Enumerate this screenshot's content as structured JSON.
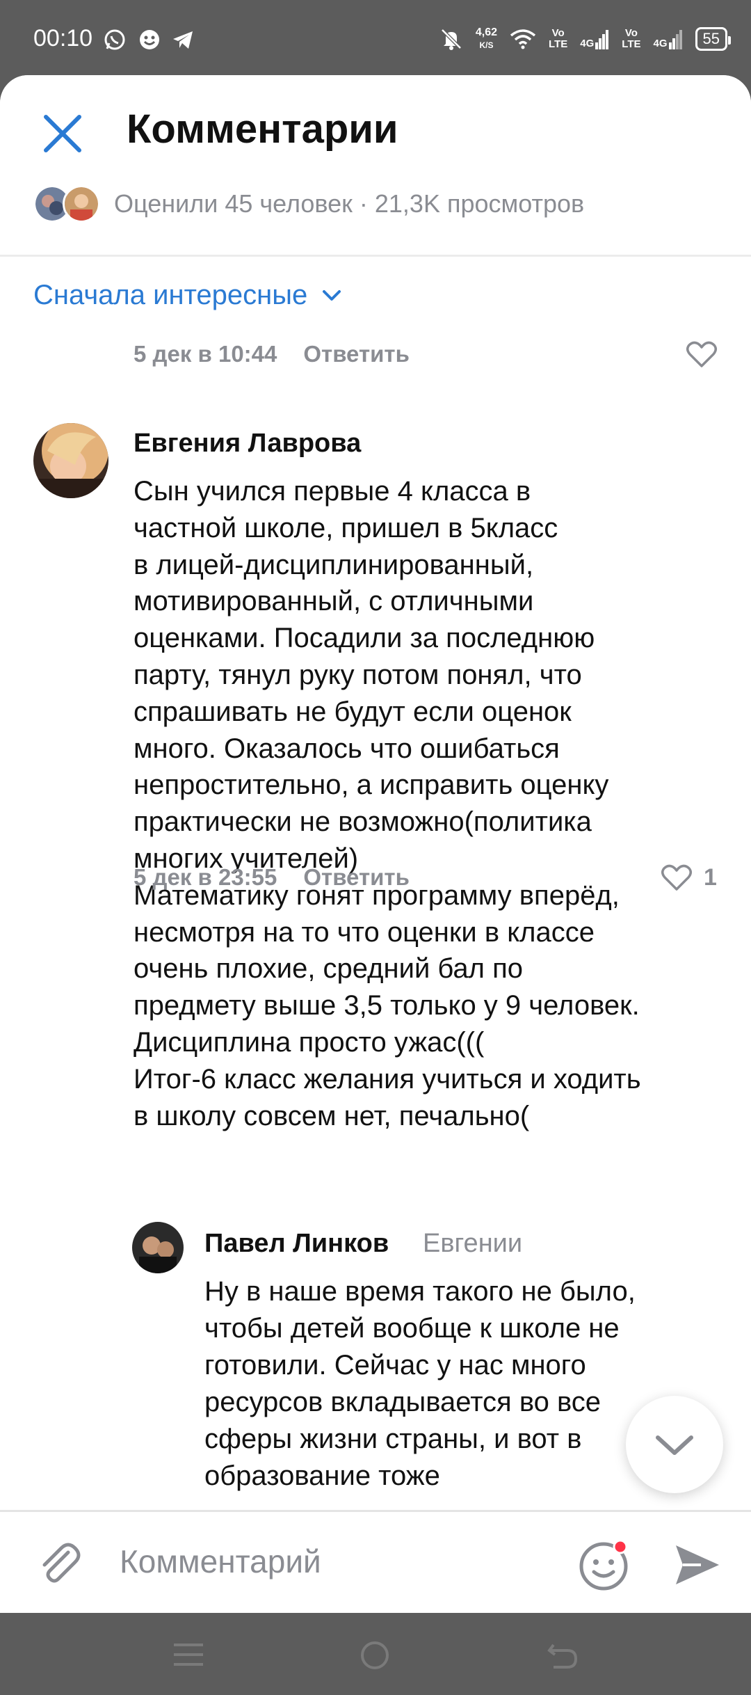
{
  "status_bar": {
    "time": "00:10",
    "net_speed_value": "4,62",
    "net_speed_unit": "K/S",
    "lte1": "Vo\nLTE",
    "sig1": "4G",
    "lte2": "Vo\nLTE",
    "sig2": "4G",
    "battery": "55",
    "icons": [
      "whatsapp-icon",
      "messenger-icon",
      "telegram-icon",
      "mute-icon",
      "wifi-icon",
      "signal-icon",
      "battery-icon"
    ]
  },
  "header": {
    "title": "Комментарии",
    "stats": "Оценили 45 человек · 21,3K просмотров"
  },
  "sort": {
    "label": "Сначала интересные"
  },
  "prev_comment": {
    "date": "5 дек в 10:44",
    "reply": "Ответить"
  },
  "comment1": {
    "author": "Евгения Лаврова",
    "text": "Сын учился первые 4 класса в\nчастной школе, пришел в 5класс\nв лицей-дисциплинированный,\nмотивированный, с отличными\nоценками. Посадили за последнюю\nпарту, тянул руку потом понял, что\nспрашивать не будут если оценок\nмного. Оказалось что ошибаться\nнепростительно, а исправить оценку\nпрактически не возможно(политика\nмногих учителей)\nМатематику гонят программу вперёд,\nнесмотря на то что оценки в классе\nочень плохие,  средний бал по\nпредмету выше 3,5 только у 9 человек.\nДисциплина просто ужас(((\nИтог-6 класс желания учиться и ходить\nв школу совсем нет, печально(",
    "date": "5 дек в 23:55",
    "reply": "Ответить",
    "likes": "1"
  },
  "comment2": {
    "author": "Павел Линков",
    "reply_to": "Евгении",
    "text": "Ну в наше время такого не было,\nчтобы детей вообще к школе не\nготовили. Сейчас у нас много\nресурсов вкладывается во все\nсферы жизни страны, и вот в\nобразование тоже"
  },
  "input": {
    "placeholder": "Комментарий"
  },
  "colors": {
    "accent": "#2a7ad3",
    "muted": "#8a8c92",
    "badge": "#ff3347"
  }
}
